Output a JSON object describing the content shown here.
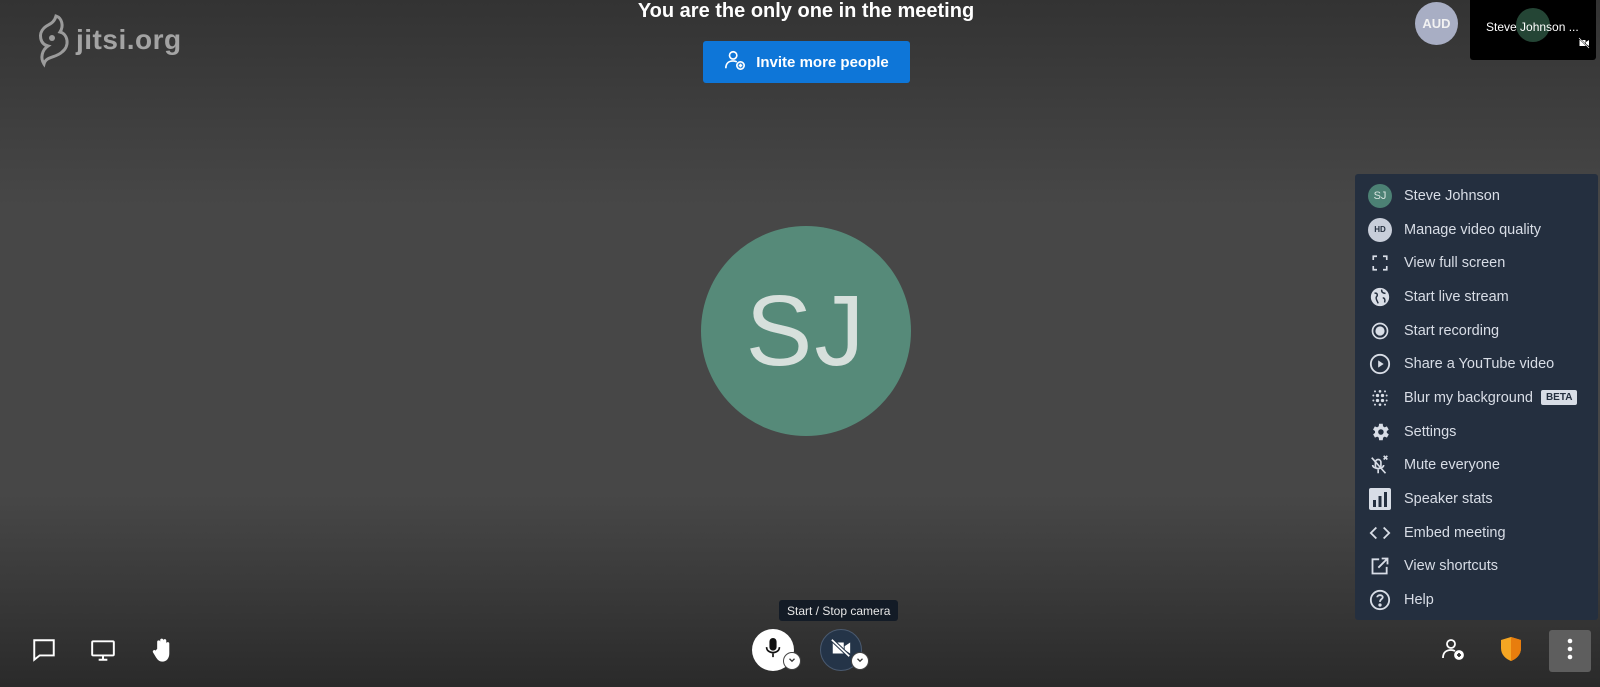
{
  "brand": {
    "logo_text": "jitsi.org"
  },
  "notice": {
    "title": "You are the only one in the meeting",
    "invite_label": "Invite more people"
  },
  "filmstrip": {
    "aud_initials": "AUD",
    "thumb_name": "Steve Johnson ..."
  },
  "main": {
    "initials": "SJ"
  },
  "menu": {
    "items": [
      {
        "label": "Steve Johnson",
        "icon": "user-avatar-icon",
        "avatar": "SJ"
      },
      {
        "label": "Manage video quality",
        "icon": "hd-icon",
        "avatar": "HD"
      },
      {
        "label": "View full screen",
        "icon": "fullscreen-icon"
      },
      {
        "label": "Start live stream",
        "icon": "globe-icon"
      },
      {
        "label": "Start recording",
        "icon": "record-icon"
      },
      {
        "label": "Share a YouTube video",
        "icon": "play-circle-icon"
      },
      {
        "label": "Blur my background",
        "icon": "blur-icon",
        "badge": "BETA"
      },
      {
        "label": "Settings",
        "icon": "gear-icon"
      },
      {
        "label": "Mute everyone",
        "icon": "mic-off-icon"
      },
      {
        "label": "Speaker stats",
        "icon": "bar-chart-icon"
      },
      {
        "label": "Embed meeting",
        "icon": "code-icon"
      },
      {
        "label": "View shortcuts",
        "icon": "external-link-icon"
      },
      {
        "label": "Help",
        "icon": "help-icon"
      }
    ]
  },
  "tooltip": {
    "text": "Start / Stop camera"
  },
  "colors": {
    "accent": "#0e76d8",
    "avatar_green": "#568a79",
    "menu_bg": "#242f3f",
    "shield": "#f5a623"
  }
}
